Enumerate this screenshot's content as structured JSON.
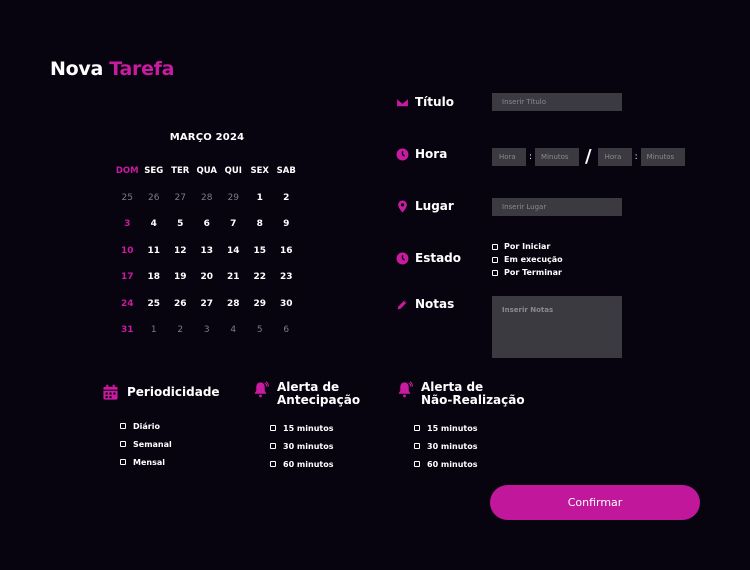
{
  "title": {
    "first": "Nova",
    "second": "Tarefa"
  },
  "calendar": {
    "month": "MARÇO 2024",
    "weekdays": [
      "DOM",
      "SEG",
      "TER",
      "QUA",
      "QUI",
      "SEX",
      "SAB"
    ],
    "weeks": [
      [
        {
          "d": "25",
          "m": true
        },
        {
          "d": "26",
          "m": true
        },
        {
          "d": "27",
          "m": true
        },
        {
          "d": "28",
          "m": true
        },
        {
          "d": "29",
          "m": true
        },
        {
          "d": "1"
        },
        {
          "d": "2"
        }
      ],
      [
        {
          "d": "3"
        },
        {
          "d": "4"
        },
        {
          "d": "5"
        },
        {
          "d": "6"
        },
        {
          "d": "7"
        },
        {
          "d": "8"
        },
        {
          "d": "9"
        }
      ],
      [
        {
          "d": "10"
        },
        {
          "d": "11"
        },
        {
          "d": "12"
        },
        {
          "d": "13"
        },
        {
          "d": "14"
        },
        {
          "d": "15"
        },
        {
          "d": "16"
        }
      ],
      [
        {
          "d": "17"
        },
        {
          "d": "18"
        },
        {
          "d": "19"
        },
        {
          "d": "20"
        },
        {
          "d": "21"
        },
        {
          "d": "22"
        },
        {
          "d": "23"
        }
      ],
      [
        {
          "d": "24"
        },
        {
          "d": "25"
        },
        {
          "d": "26"
        },
        {
          "d": "27"
        },
        {
          "d": "28"
        },
        {
          "d": "29"
        },
        {
          "d": "30"
        }
      ],
      [
        {
          "d": "31"
        },
        {
          "d": "1",
          "m": true
        },
        {
          "d": "2",
          "m": true
        },
        {
          "d": "3",
          "m": true
        },
        {
          "d": "4",
          "m": true
        },
        {
          "d": "5",
          "m": true
        },
        {
          "d": "6",
          "m": true
        }
      ]
    ]
  },
  "form": {
    "titulo": {
      "label": "Título",
      "placeholder": "Inserir Título",
      "icon": "envelope-icon"
    },
    "hora": {
      "label": "Hora",
      "icon": "clock-icon",
      "start_hour_placeholder": "Hora",
      "start_min_placeholder": "Minutos",
      "end_hour_placeholder": "Hora",
      "end_min_placeholder": "Minutos",
      "colon": ":",
      "slash": "/"
    },
    "lugar": {
      "label": "Lugar",
      "placeholder": "Inserir Lugar",
      "icon": "location-pin-icon"
    },
    "estado": {
      "label": "Estado",
      "icon": "clock-icon",
      "options": [
        "Por Iniciar",
        "Em execução",
        "Por Terminar"
      ]
    },
    "notas": {
      "label": "Notas",
      "placeholder": "Inserir Notas",
      "icon": "pencil-icon"
    }
  },
  "periodicidade": {
    "title": "Periodicidade",
    "icon": "calendar-icon",
    "options": [
      "Diário",
      "Semanal",
      "Mensal"
    ]
  },
  "antecipacao": {
    "title_line1": "Alerta de",
    "title_line2": "Antecipação",
    "icon": "bell-icon",
    "options": [
      "15 minutos",
      "30 minutos",
      "60 minutos"
    ]
  },
  "nao_realizacao": {
    "title_line1": "Alerta de",
    "title_line2": "Não-Realização",
    "icon": "bell-icon",
    "options": [
      "15 minutos",
      "30 minutos",
      "60 minutos"
    ]
  },
  "confirm_label": "Confirmar",
  "colors": {
    "accent": "#c81ba0",
    "background": "#07040f",
    "input": "#3b3a40",
    "button": "#c1179a"
  }
}
